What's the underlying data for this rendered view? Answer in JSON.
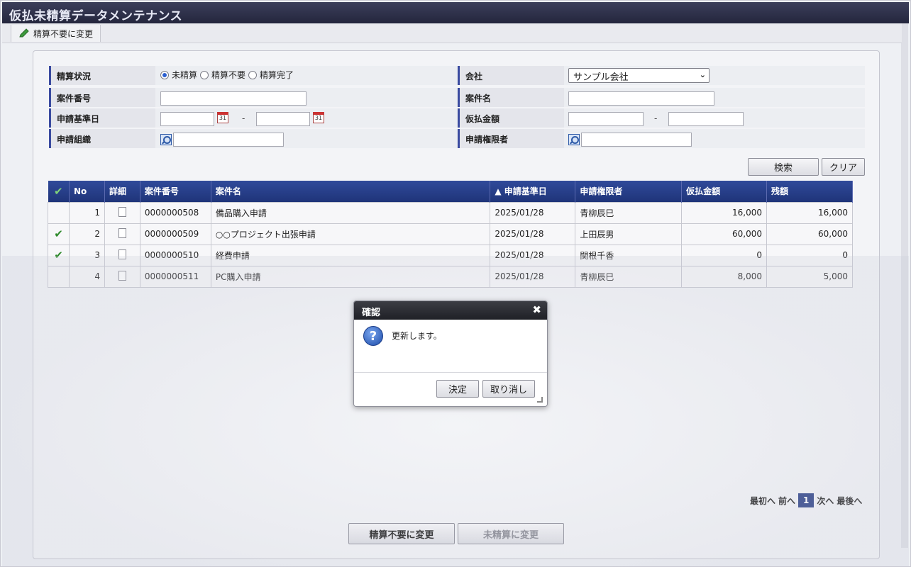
{
  "window": {
    "title": "仮払未精算データメンテナンス"
  },
  "toolbar": {
    "change_unneeded_label": "精算不要に変更"
  },
  "form": {
    "status_label": "精算状況",
    "status_options": [
      "未精算",
      "精算不要",
      "精算完了"
    ],
    "status_selected": "未精算",
    "company_label": "会社",
    "company_value": "サンプル会社",
    "case_no_label": "案件番号",
    "case_name_label": "案件名",
    "apply_date_label": "申請基準日",
    "amount_label": "仮払金額",
    "org_label": "申請組織",
    "authority_label": "申請権限者",
    "range_sep": "-",
    "calendar_day": "31"
  },
  "actions": {
    "search_label": "検索",
    "clear_label": "クリア"
  },
  "table": {
    "headers": [
      "No",
      "詳細",
      "案件番号",
      "案件名",
      "▲ 申請基準日",
      "申請権限者",
      "仮払金額",
      "残額"
    ],
    "rows": [
      {
        "checked": false,
        "no": "1",
        "case_no": "0000000508",
        "case_name": "備品購入申請",
        "date": "2025/01/28",
        "authority": "青柳辰巳",
        "amount": "16,000",
        "balance": "16,000"
      },
      {
        "checked": true,
        "no": "2",
        "case_no": "0000000509",
        "case_name": "○○プロジェクト出張申請",
        "date": "2025/01/28",
        "authority": "上田辰男",
        "amount": "60,000",
        "balance": "60,000"
      },
      {
        "checked": true,
        "no": "3",
        "case_no": "0000000510",
        "case_name": "経費申請",
        "date": "2025/01/28",
        "authority": "関根千香",
        "amount": "0",
        "balance": "0"
      },
      {
        "checked": false,
        "no": "4",
        "case_no": "0000000511",
        "case_name": "PC購入申請",
        "date": "2025/01/28",
        "authority": "青柳辰巳",
        "amount": "8,000",
        "balance": "5,000"
      }
    ]
  },
  "pager": {
    "first": "最初へ",
    "prev": "前へ",
    "current": "1",
    "next": "次へ",
    "last": "最後へ"
  },
  "bottom": {
    "change_unneeded": "精算不要に変更",
    "change_unsettled": "未精算に変更"
  },
  "dialog": {
    "title": "確認",
    "message": "更新します。",
    "ok_label": "決定",
    "cancel_label": "取り消し",
    "close_glyph": "✖",
    "icon_glyph": "?"
  },
  "colors": {
    "header_blue": "#24377f",
    "title_bar": "#24263d",
    "check_green": "#2f8a2c"
  }
}
